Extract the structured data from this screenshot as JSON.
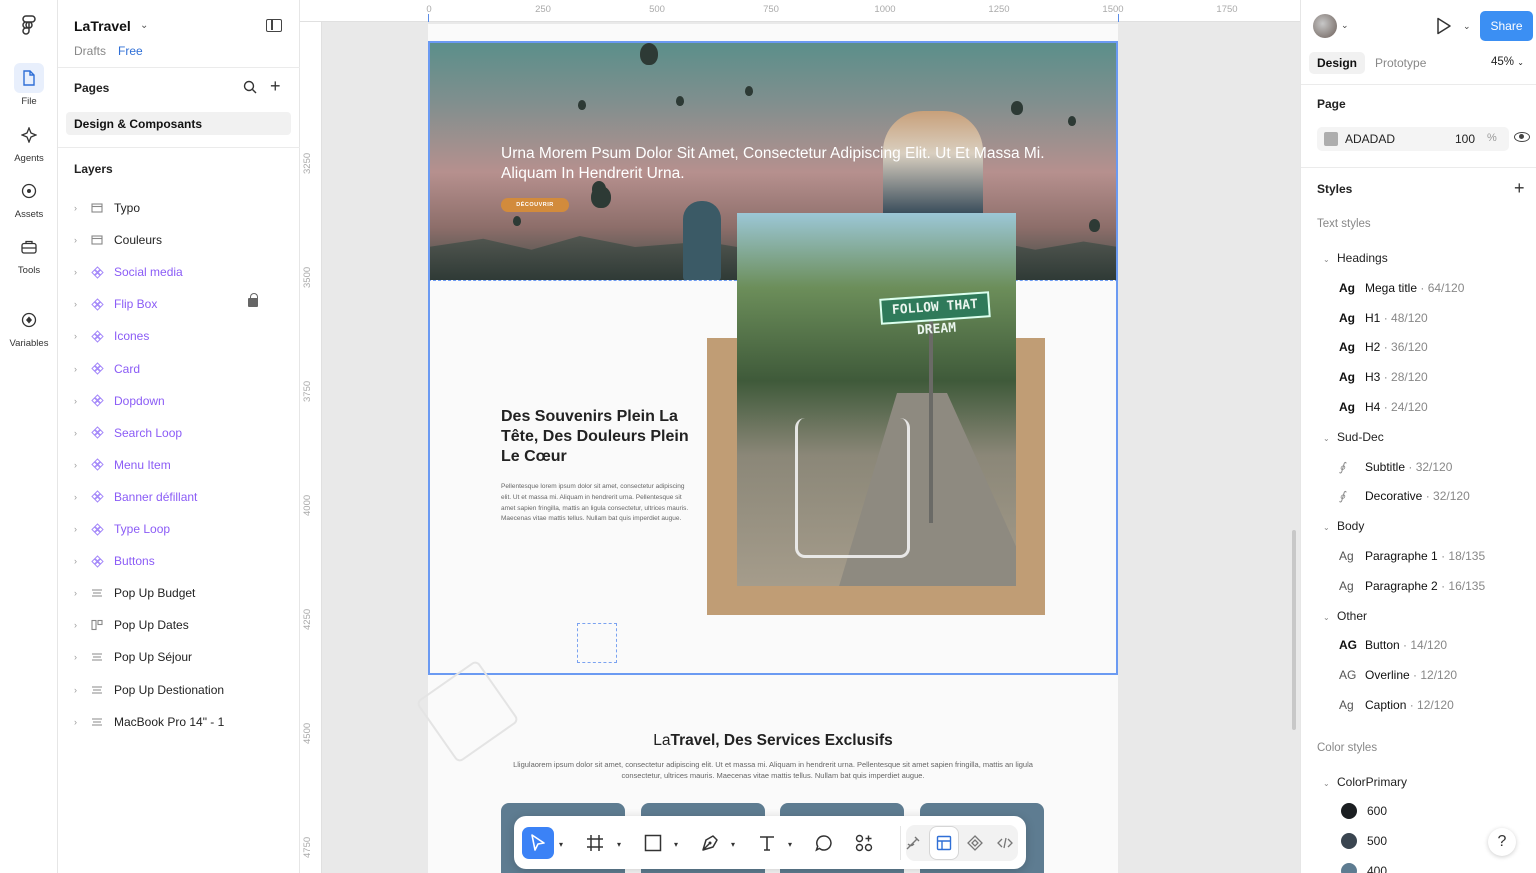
{
  "rail": {
    "items": [
      {
        "label": "File",
        "icon": "file-icon"
      },
      {
        "label": "Agents",
        "icon": "sparkle-icon"
      },
      {
        "label": "Assets",
        "icon": "plus-circle-icon"
      },
      {
        "label": "Tools",
        "icon": "briefcase-icon"
      },
      {
        "label": "Variables",
        "icon": "variables-icon"
      }
    ]
  },
  "project": {
    "name": "LaTravel",
    "location": "Drafts",
    "plan": "Free"
  },
  "pages": {
    "title": "Pages",
    "items": [
      "Design & Composants"
    ]
  },
  "layers": {
    "title": "Layers",
    "items": [
      {
        "name": "Typo",
        "kind": "frame"
      },
      {
        "name": "Couleurs",
        "kind": "frame"
      },
      {
        "name": "Social media",
        "kind": "component"
      },
      {
        "name": "Flip Box",
        "kind": "component"
      },
      {
        "name": "Icones",
        "kind": "component"
      },
      {
        "name": "Card",
        "kind": "component"
      },
      {
        "name": "Dopdown",
        "kind": "component"
      },
      {
        "name": "Search Loop",
        "kind": "component"
      },
      {
        "name": "Menu Item",
        "kind": "component"
      },
      {
        "name": "Banner défillant",
        "kind": "component"
      },
      {
        "name": "Type Loop",
        "kind": "component"
      },
      {
        "name": "Buttons",
        "kind": "component"
      },
      {
        "name": "Pop Up Budget",
        "kind": "stack"
      },
      {
        "name": "Pop Up Dates",
        "kind": "columns"
      },
      {
        "name": "Pop Up Séjour",
        "kind": "stack"
      },
      {
        "name": "Pop Up Destionation",
        "kind": "stack"
      },
      {
        "name": "MacBook Pro 14\" - 1",
        "kind": "stack"
      }
    ]
  },
  "canvas": {
    "ruler_x": [
      "0",
      "250",
      "500",
      "750",
      "1000",
      "1250",
      "1500",
      "1750"
    ],
    "ruler_y": [
      "3250",
      "3500",
      "3750",
      "4000",
      "4250",
      "4500",
      "4750"
    ],
    "hero_text": "Urna Morem Psum Dolor Sit Amet, Consectetur Adipiscing Elit. Ut Et Massa Mi. Aliquam In Hendrerit Urna.",
    "hero_button": "DÉCOUVRIR",
    "sign_text": "FOLLOW THAT DREAM",
    "section_title": "Des Souvenirs Plein La Tête, Des Douleurs Plein Le Cœur",
    "section_body": "Pellentesque lorem ipsum dolor sit amet, consectetur adipiscing elit. Ut et massa mi. Aliquam in hendrerit urna. Pellentesque sit amet sapien fringilla, mattis an ligula consectetur, ultrices mauris. Maecenas vitae mattis tellus. Nullam bat quis imperdiet augue.",
    "services_title_light": "La",
    "services_title_bold": "Travel, Des Services Exclusifs",
    "services_body": "Lligulaorem ipsum dolor sit amet, consectetur adipiscing elit. Ut et massa mi. Aliquam in hendrerit urna. Pellentesque sit amet sapien fringilla, mattis an ligula consectetur, ultrices mauris. Maecenas vitae mattis tellus. Nullam bat quis imperdiet augue."
  },
  "toolbar": {
    "tools": [
      "move-tool",
      "frame-tool",
      "rectangle-tool",
      "pen-tool",
      "text-tool",
      "comment-tool",
      "actions-tool"
    ],
    "modes": [
      "draw-mode",
      "design-mode",
      "dev-component-mode",
      "dev-mode"
    ]
  },
  "right": {
    "share_label": "Share",
    "tabs": [
      "Design",
      "Prototype"
    ],
    "zoom": "45%",
    "page_label": "Page",
    "page_color": "ADADAD",
    "page_opacity": "100",
    "pct": "%",
    "styles_label": "Styles",
    "text_styles_label": "Text styles",
    "groups": [
      {
        "name": "Headings",
        "styles": [
          {
            "name": "Mega title",
            "meta": "· 64/120"
          },
          {
            "name": "H1",
            "meta": "· 48/120"
          },
          {
            "name": "H2",
            "meta": "· 36/120"
          },
          {
            "name": "H3",
            "meta": "· 28/120"
          },
          {
            "name": "H4",
            "meta": "· 24/120"
          }
        ]
      },
      {
        "name": "Sud-Dec",
        "styles": [
          {
            "name": "Subtitle",
            "meta": "· 32/120"
          },
          {
            "name": "Decorative",
            "meta": "· 32/120"
          }
        ]
      },
      {
        "name": "Body",
        "styles": [
          {
            "name": "Paragraphe 1",
            "meta": "· 18/135"
          },
          {
            "name": "Paragraphe 2",
            "meta": "· 16/135"
          }
        ]
      },
      {
        "name": "Other",
        "styles": [
          {
            "name": "Button",
            "meta": "· 14/120"
          },
          {
            "name": "Overline",
            "meta": "· 12/120"
          },
          {
            "name": "Caption",
            "meta": "· 12/120"
          }
        ]
      }
    ],
    "ag_glyph": "Ag",
    "ag_upper": "AG",
    "color_styles_label": "Color styles",
    "color_group": "ColorPrimary",
    "colors": [
      {
        "name": "600",
        "hex": "#1b1f22"
      },
      {
        "name": "500",
        "hex": "#3a4550"
      },
      {
        "name": "400",
        "hex": "#5e7c91"
      }
    ],
    "help": "?"
  },
  "colors": {
    "accent": "#3b8ff3",
    "selection": "#6b9af2",
    "component": "#8b5cf6",
    "tan": "#c09d75",
    "hero_button": "#d28b3c"
  }
}
